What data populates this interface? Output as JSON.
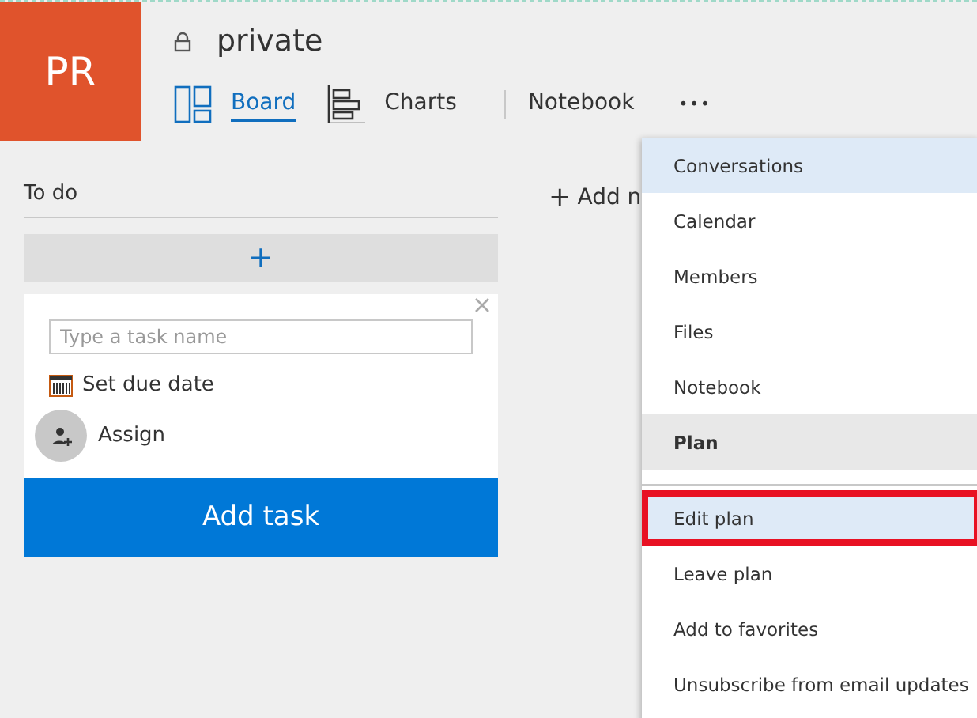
{
  "logo": {
    "initials": "PR"
  },
  "title": {
    "text": "private",
    "locked": true
  },
  "tabs": [
    {
      "label": "Board",
      "selected": true,
      "kind": "board"
    },
    {
      "label": "Charts",
      "selected": false,
      "kind": "charts"
    },
    {
      "label": "Notebook",
      "selected": false,
      "kind": "plain"
    }
  ],
  "more_button": {
    "label": "•••"
  },
  "bucket": {
    "title": "To do",
    "add_symbol": "+",
    "task_name": {
      "placeholder": "Type a task name"
    },
    "due_date": "Set due date",
    "assign": "Assign",
    "submit": "Add task"
  },
  "add_bucket": {
    "symbol": "+",
    "label": "Add n"
  },
  "menu": [
    {
      "kind": "item",
      "label": "Conversations",
      "selected": true,
      "outlined": false
    },
    {
      "kind": "item",
      "label": "Calendar",
      "selected": false,
      "outlined": false
    },
    {
      "kind": "item",
      "label": "Members",
      "selected": false,
      "outlined": false
    },
    {
      "kind": "item",
      "label": "Files",
      "selected": false,
      "outlined": false
    },
    {
      "kind": "item",
      "label": "Notebook",
      "selected": false,
      "outlined": false
    },
    {
      "kind": "header",
      "label": "Plan"
    },
    {
      "kind": "divider"
    },
    {
      "kind": "item",
      "label": "Edit plan",
      "selected": true,
      "outlined": true
    },
    {
      "kind": "item",
      "label": "Leave plan",
      "selected": false,
      "outlined": false
    },
    {
      "kind": "item",
      "label": "Add to favorites",
      "selected": false,
      "outlined": false
    },
    {
      "kind": "item",
      "label": "Unsubscribe from email updates",
      "selected": false,
      "outlined": false
    }
  ]
}
